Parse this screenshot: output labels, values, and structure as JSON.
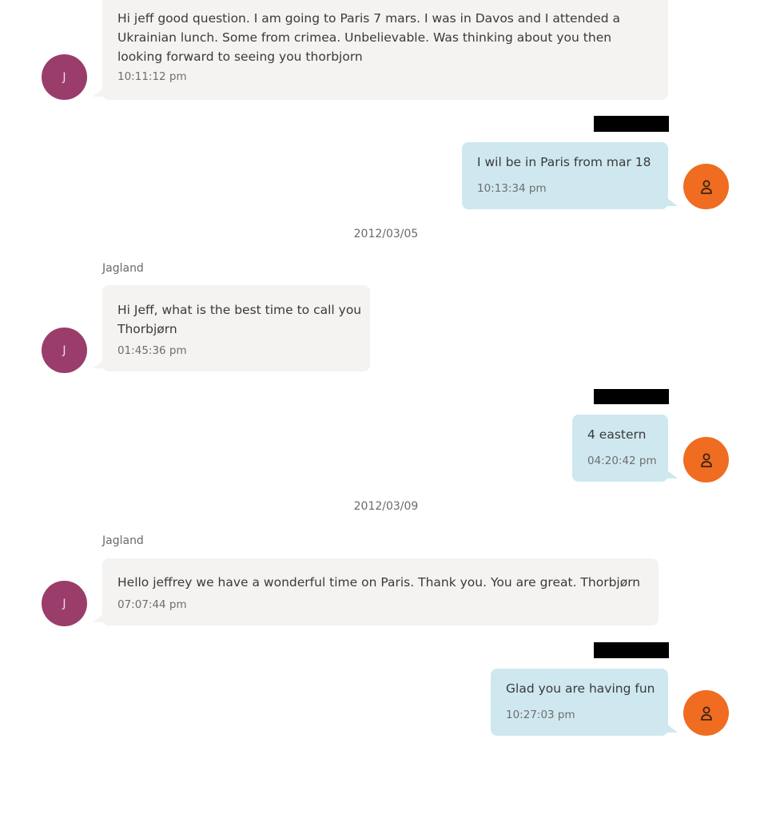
{
  "messages": [
    {
      "text": " Hi jeff good question. I am  going to Paris 7 mars. I was in Davos and I attended a\nUkrainian lunch. Some from crimea. Unbelievable. Was thinking about you then\nlooking forward to seeing you thorbjorn",
      "time": "10:11:12 pm"
    },
    {
      "text": "I wil be in Paris from mar 18",
      "time": "10:13:34 pm"
    },
    {
      "text": "Hi Jeff, what is the best time to call you\nThorbjørn",
      "time": "01:45:36 pm"
    },
    {
      "text": "4 eastern",
      "time": "04:20:42 pm"
    },
    {
      "text": "Hello jeffrey  we have a wonderful time on Paris. Thank you. You are great. Thorbjørn",
      "time": "07:07:44 pm"
    },
    {
      "text": "Glad you are having fun",
      "time": "10:27:03 pm"
    }
  ],
  "dates": [
    "2012/03/05",
    "2012/03/09"
  ],
  "senders": [
    "Jagland",
    "Jagland"
  ],
  "avatar_initial": "J",
  "colors": {
    "incoming_bubble": "#f4f3f1",
    "outgoing_bubble": "#cfe8ef",
    "incoming_avatar": "#9a3d6b",
    "outgoing_avatar": "#ef6c21",
    "redaction": "#000000"
  },
  "icons": {
    "outgoing_avatar": "person-icon"
  }
}
